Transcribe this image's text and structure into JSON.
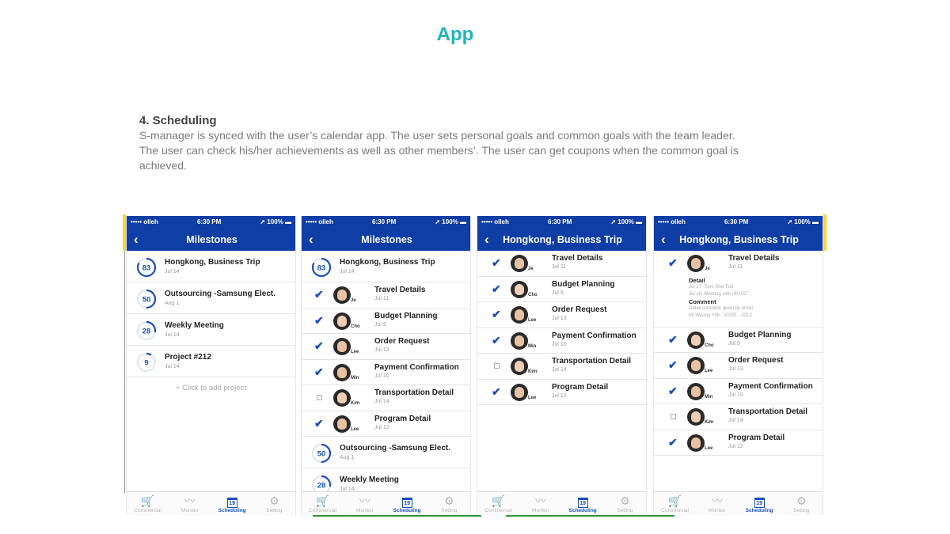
{
  "page": {
    "title": "App",
    "section_heading": "4. Scheduling",
    "section_body": "S-manager is synced with the user’s calendar app. The user sets personal goals and common goals with the team leader. The user can check his/her achievements as well as other members’. The user can get coupons when the common goal is achieved."
  },
  "status": {
    "carrier": "••••• olleh",
    "time": "6:30 PM",
    "battery": "100%"
  },
  "tabs": [
    "Commercial",
    "Monitor",
    "Scheduling",
    "Setting"
  ],
  "calendar_day": "19",
  "milestones": [
    {
      "pct": "83",
      "name": "Hongkong, Business Trip",
      "date": "Jul 14"
    },
    {
      "pct": "50",
      "name": "Outsourcing -Samsung Elect.",
      "date": "Aug 1"
    },
    {
      "pct": "28",
      "name": "Weekly Meeting",
      "date": "Jul 14"
    },
    {
      "pct": "9",
      "name": "Project #212",
      "date": "Jul 14"
    }
  ],
  "tasks": [
    {
      "name": "Travel Details",
      "date": "Jul 11",
      "who": "Je",
      "done": "true"
    },
    {
      "name": "Budget Planning",
      "date": "Jul 9",
      "who": "Cho",
      "done": "true"
    },
    {
      "name": "Order Request",
      "date": "Jul 13",
      "who": "Lee",
      "done": "true"
    },
    {
      "name": "Payment Confirmation",
      "date": "Jul 10",
      "who": "Min",
      "done": "true"
    },
    {
      "name": "Transportation Detail",
      "date": "Jul 14",
      "who": "Kim",
      "done": "false"
    },
    {
      "name": "Program Detail",
      "date": "Jul 12",
      "who": "Lee",
      "done": "true"
    }
  ],
  "screen1": {
    "title": "Milestones",
    "add_label": "+ Click to add project"
  },
  "screen2": {
    "title": "Milestones"
  },
  "screen3": {
    "title": "Hongkong, Business Trip"
  },
  "screen4": {
    "title": "Hongkong, Business Trip",
    "detail_label": "Detail",
    "detail_line1": "Jul 17. Tsim Sha Tsui",
    "detail_line2": "Jul 18. Meeting with HKUST",
    "comment_label": "Comment",
    "comment_line1": "Detail schedule given by email",
    "comment_line2": "Mr.Waung +38 - 30281 - 2312"
  },
  "colors": {
    "accent": "#1fb4b9",
    "nav": "#0f3ea6",
    "check": "#1a50b8",
    "edge": "#ffd52a"
  }
}
